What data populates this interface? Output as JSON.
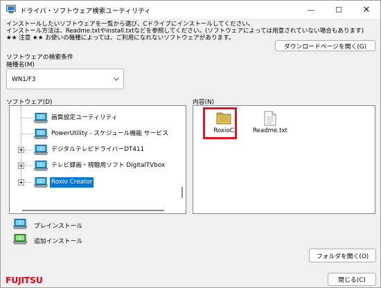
{
  "window": {
    "title": "ドライバ・ソフトウェア検索ユーティリティ",
    "minimize": "—",
    "maximize": "☐",
    "close": "✕"
  },
  "info": {
    "line1": "インストールしたいソフトウェアを一覧から選び、Cドライブにインストールしてください。",
    "line2": "インストール方法は、Readme.txtやinstall.txtなどを参照してください。(ソフトウェアによっては用意されていない場合もあります)",
    "line3": "★★ 注意 ★★ お使いの機種によっては、ご利用になれないソフトウェアがあります。"
  },
  "download_button": "ダウンロードページを開く(G)",
  "search": {
    "section_label": "ソフトウェアの検索条件",
    "model_label": "機種名(M)",
    "model_value": "WN1/F3"
  },
  "software": {
    "label": "ソフトウェア(D)",
    "items": [
      {
        "label": "画質設定ユーティリティ",
        "expandable": false,
        "selected": false,
        "icon": "preinstall-icon"
      },
      {
        "label": "PowerUtility - スケジュール機能 サービス",
        "expandable": false,
        "selected": false,
        "icon": "preinstall-icon"
      },
      {
        "label": "デジタルテレビドライバーDT411",
        "expandable": true,
        "selected": false,
        "icon": "preinstall-icon"
      },
      {
        "label": "テレビ録画・視聴用ソフト DigitalTVbox",
        "expandable": true,
        "selected": false,
        "icon": "preinstall-icon"
      },
      {
        "label": "Roxio Creator",
        "expandable": true,
        "selected": true,
        "icon": "preinstall-icon"
      }
    ]
  },
  "contents": {
    "label": "内容(N)",
    "files": [
      {
        "name": "RoxioC",
        "type": "folder",
        "icon": "folder-icon"
      },
      {
        "name": "Readme.txt",
        "type": "text",
        "icon": "text-file-icon"
      }
    ]
  },
  "legend": {
    "preinstall": "プレインストール",
    "additional": "追加インストール"
  },
  "folder_button": "フォルダを開く(O)",
  "close_button": "閉じる(C)",
  "logo": "FUJITSU",
  "colors": {
    "selection": "#0078d7",
    "highlight": "#e0141e",
    "logo": "#e60012",
    "preinstall_icon": "#1f9bd6",
    "additional_icon": "#3aa935"
  }
}
